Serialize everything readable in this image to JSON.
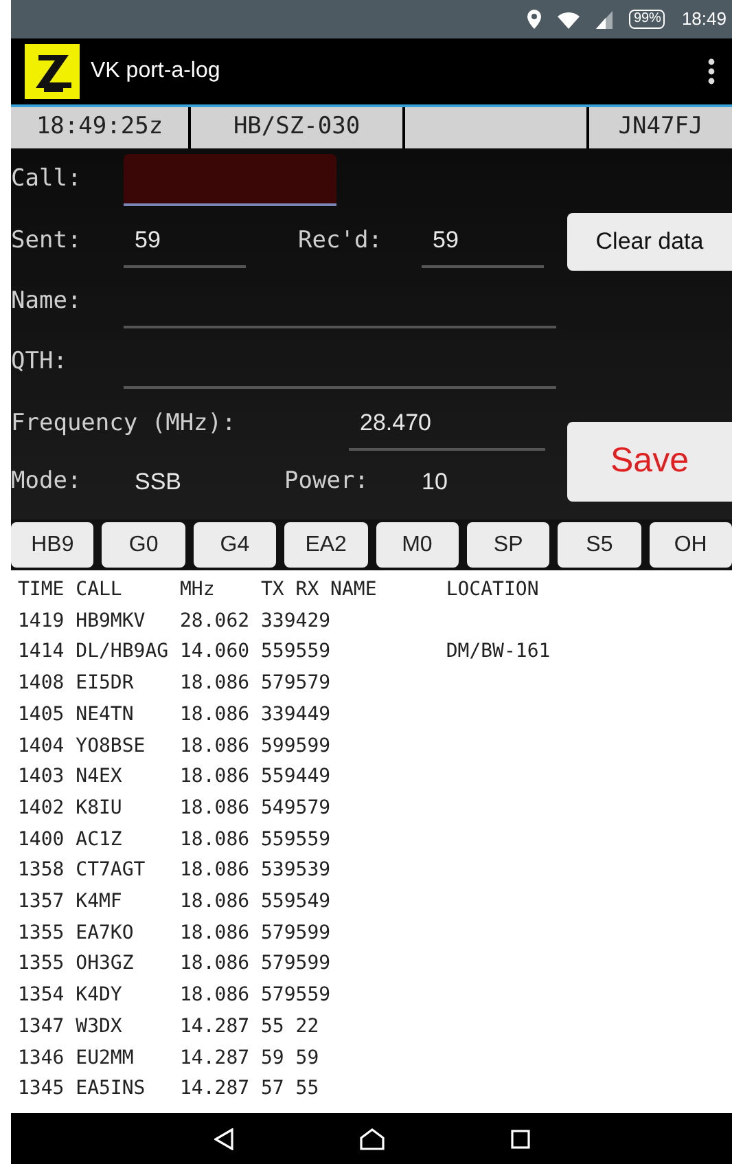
{
  "status_bar": {
    "battery": "99%",
    "time": "18:49"
  },
  "app_bar": {
    "title": "VK port-a-log"
  },
  "info_row": {
    "utc_time": "18:49:25z",
    "summit_reference": "HB/SZ-030",
    "locator": "JN47FJ"
  },
  "form": {
    "call": {
      "label": "Call:"
    },
    "sent": {
      "label": "Sent:",
      "value": "59"
    },
    "received": {
      "label": "Rec'd:",
      "value": "59"
    },
    "name": {
      "label": "Name:"
    },
    "qth": {
      "label": "QTH:"
    },
    "frequency": {
      "label": "Frequency (MHz):",
      "value": "28.470"
    },
    "mode": {
      "label": "Mode:",
      "value": "SSB"
    },
    "power": {
      "label": "Power:",
      "value": "10"
    },
    "buttons": [
      {
        "label": "Clear data",
        "kind": "clear"
      },
      {
        "label": "Save",
        "kind": "save"
      }
    ]
  },
  "prefix_buttons": [
    "HB9",
    "G0",
    "G4",
    "EA2",
    "M0",
    "SP",
    "S5",
    "OH"
  ],
  "log": {
    "columns": [
      "TIME",
      "CALL",
      "MHz",
      "TX",
      "RX",
      "NAME",
      "LOCATION"
    ],
    "rows": [
      {
        "time": "1419",
        "call": "HB9MKV",
        "mhz": "28.062",
        "report": "339429"
      },
      {
        "time": "1414",
        "call": "DL/HB9AG",
        "mhz": "14.060",
        "report": "559559",
        "location": "DM/BW-161"
      },
      {
        "time": "1408",
        "call": "EI5DR",
        "mhz": "18.086",
        "report": "579579"
      },
      {
        "time": "1405",
        "call": "NE4TN",
        "mhz": "18.086",
        "report": "339449"
      },
      {
        "time": "1404",
        "call": "YO8BSE",
        "mhz": "18.086",
        "report": "599599"
      },
      {
        "time": "1403",
        "call": "N4EX",
        "mhz": "18.086",
        "report": "559449"
      },
      {
        "time": "1402",
        "call": "K8IU",
        "mhz": "18.086",
        "report": "549579"
      },
      {
        "time": "1400",
        "call": "AC1Z",
        "mhz": "18.086",
        "report": "559559"
      },
      {
        "time": "1358",
        "call": "CT7AGT",
        "mhz": "18.086",
        "report": "539539"
      },
      {
        "time": "1357",
        "call": "K4MF",
        "mhz": "18.086",
        "report": "559549"
      },
      {
        "time": "1355",
        "call": "EA7KO",
        "mhz": "18.086",
        "report": "579599"
      },
      {
        "time": "1355",
        "call": "OH3GZ",
        "mhz": "18.086",
        "report": "579599"
      },
      {
        "time": "1354",
        "call": "K4DY",
        "mhz": "18.086",
        "report": "579559"
      },
      {
        "time": "1347",
        "call": "W3DX",
        "mhz": "14.287",
        "report": "55 22"
      },
      {
        "time": "1346",
        "call": "EU2MM",
        "mhz": "14.287",
        "report": "59 59"
      },
      {
        "time": "1345",
        "call": "EA5INS",
        "mhz": "14.287",
        "report": "57 55"
      }
    ]
  }
}
